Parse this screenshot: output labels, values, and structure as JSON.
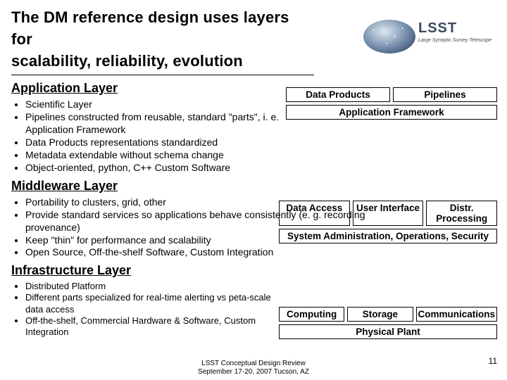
{
  "title_line1": "The DM reference design uses layers for",
  "title_line2": "scalability, reliability, evolution",
  "logo": {
    "acronym": "LSST",
    "full": "Large Synoptic Survey Telescope"
  },
  "app": {
    "heading": "Application Layer",
    "bullets": [
      "Scientific Layer",
      "Pipelines constructed from reusable, standard \"parts\", i. e. Application Framework",
      "Data Products representations standardized",
      "Metadata extendable without schema change",
      "Object-oriented, python, C++ Custom Software"
    ],
    "box_top_left": "Data Products",
    "box_top_right": "Pipelines",
    "box_bottom": "Application Framework"
  },
  "mw": {
    "heading": "Middleware Layer",
    "bullets": [
      "Portability to clusters, grid, other",
      "Provide standard services so applications behave consistently (e. g. recording provenance)",
      "Keep \"thin\" for performance and scalability",
      "Open Source, Off-the-shelf Software, Custom Integration"
    ],
    "box_a": "Data Access",
    "box_b": "User Interface",
    "box_c": "Distr. Processing",
    "box_bottom": "System Administration, Operations, Security"
  },
  "infra": {
    "heading": "Infrastructure Layer",
    "bullets": [
      "Distributed Platform",
      "Different parts specialized for real-time alerting vs peta-scale data access",
      "Off-the-shelf, Commercial Hardware & Software, Custom Integration"
    ],
    "box_a": "Computing",
    "box_b": "Storage",
    "box_c": "Communications",
    "box_bottom": "Physical Plant"
  },
  "footer_line1": "LSST Conceptual Design Review",
  "footer_line2": "September 17-20, 2007 Tucson, AZ",
  "page_number": "11"
}
